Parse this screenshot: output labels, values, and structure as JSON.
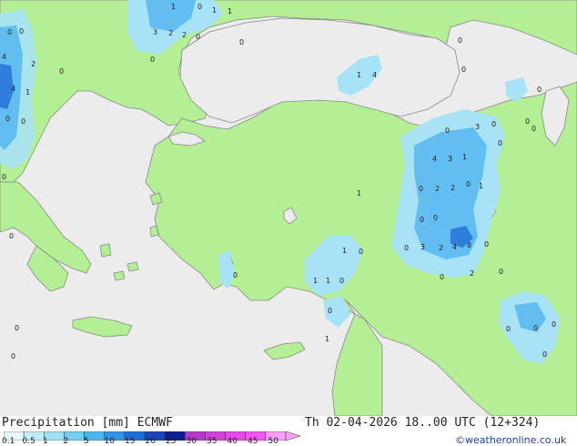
{
  "title": {
    "left": "Precipitation [mm]",
    "model": "ECMWF",
    "valid": "Th 02-04-2026 18..00 UTC (12+324)",
    "credit": "©weatheronline.co.uk"
  },
  "legend": {
    "labels": [
      "0.1",
      "0.5",
      "1",
      "2",
      "5",
      "10",
      "15",
      "20",
      "25",
      "30",
      "35",
      "40",
      "45",
      "50"
    ],
    "colors": [
      "#e6f7fb",
      "#c3ecf7",
      "#9fe0f4",
      "#74cfee",
      "#4fb6ea",
      "#3593e2",
      "#1f6fd3",
      "#1946b8",
      "#0b1e93",
      "#b23bc8",
      "#cf43d7",
      "#e24be5",
      "#f057f0",
      "#f8a0f8"
    ]
  },
  "colors": {
    "sea": "#ececec",
    "land": "#b4ef96",
    "coast": "#888888",
    "light_rain": "#a7e2f6",
    "mid_rain": "#62bdf0",
    "heavy_rain": "#2e7fdc"
  },
  "values": [
    {
      "t": "1"
    },
    {
      "t": "1"
    },
    {
      "t": "1"
    },
    {
      "t": "0"
    },
    {
      "t": "3"
    },
    {
      "t": "2"
    },
    {
      "t": "2"
    },
    {
      "t": "0"
    },
    {
      "t": "0"
    },
    {
      "t": "0"
    },
    {
      "t": "0"
    },
    {
      "t": "0"
    },
    {
      "t": "4"
    },
    {
      "t": "2"
    },
    {
      "t": "4"
    },
    {
      "t": "1"
    },
    {
      "t": "0"
    },
    {
      "t": "0"
    },
    {
      "t": "0"
    },
    {
      "t": "0"
    },
    {
      "t": "1"
    },
    {
      "t": "4"
    },
    {
      "t": "0"
    },
    {
      "t": "0"
    },
    {
      "t": "3"
    },
    {
      "t": "0"
    },
    {
      "t": "0"
    },
    {
      "t": "0"
    },
    {
      "t": "0"
    },
    {
      "t": "4"
    },
    {
      "t": "3"
    },
    {
      "t": "1"
    },
    {
      "t": "0"
    },
    {
      "t": "2"
    },
    {
      "t": "2"
    },
    {
      "t": "0"
    },
    {
      "t": "1"
    },
    {
      "t": "1"
    },
    {
      "t": "0"
    },
    {
      "t": "0"
    },
    {
      "t": "3"
    },
    {
      "t": "2"
    },
    {
      "t": "4"
    },
    {
      "t": "8"
    },
    {
      "t": "0"
    },
    {
      "t": "0"
    },
    {
      "t": "0"
    },
    {
      "t": "2"
    },
    {
      "t": "0"
    },
    {
      "t": "0"
    },
    {
      "t": "1"
    },
    {
      "t": "0"
    },
    {
      "t": "1"
    },
    {
      "t": "1"
    },
    {
      "t": "0"
    },
    {
      "t": "1"
    },
    {
      "t": "0"
    },
    {
      "t": "0"
    },
    {
      "t": "0"
    },
    {
      "t": "0"
    },
    {
      "t": "0"
    },
    {
      "t": "0"
    },
    {
      "t": "0"
    },
    {
      "t": "0"
    },
    {
      "t": "0"
    },
    {
      "t": "0"
    }
  ]
}
